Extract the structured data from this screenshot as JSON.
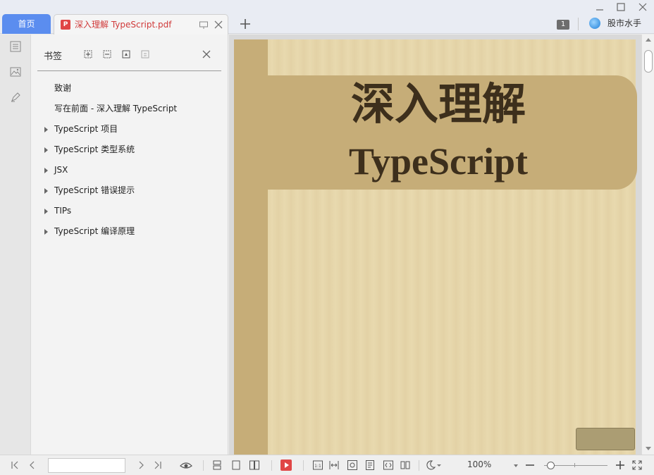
{
  "tabs": {
    "home_label": "首页",
    "doc_title": "深入理解 TypeScript.pdf"
  },
  "header": {
    "page_badge": "1",
    "stock_label": "股市水手"
  },
  "bookmarks": {
    "title": "书签",
    "items": [
      {
        "label": "致谢",
        "expandable": false
      },
      {
        "label": "写在前面 - 深入理解 TypeScript",
        "expandable": false
      },
      {
        "label": "TypeScript 项目",
        "expandable": true
      },
      {
        "label": "TypeScript 类型系统",
        "expandable": true
      },
      {
        "label": "JSX",
        "expandable": true
      },
      {
        "label": "TypeScript 错误提示",
        "expandable": true
      },
      {
        "label": "TIPs",
        "expandable": true
      },
      {
        "label": "TypeScript 编译原理",
        "expandable": true
      }
    ]
  },
  "cover": {
    "title_cn": "深入理解",
    "title_en": "TypeScript"
  },
  "statusbar": {
    "page_input_value": "",
    "zoom": "100%",
    "zoom_level": 0.1
  },
  "colors": {
    "home_tab": "#5b8def",
    "doc_tab_text": "#d03a3a",
    "cover_bg": "#e8d9ae",
    "cover_band": "#c6ad78",
    "cover_text": "#3d2f1c"
  }
}
